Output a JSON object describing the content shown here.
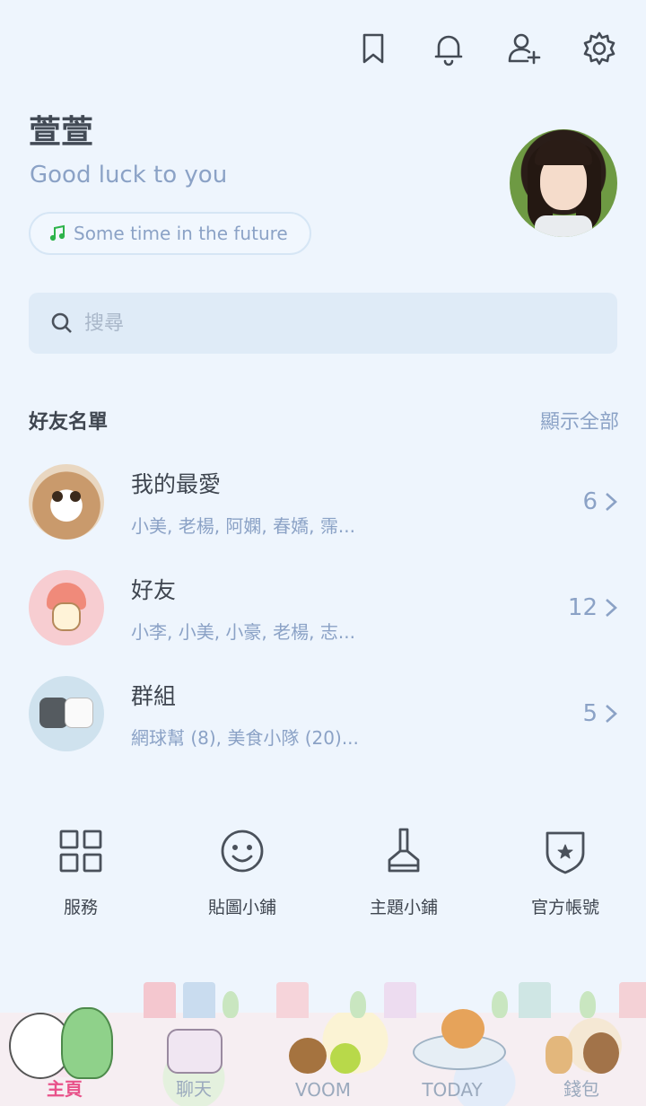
{
  "header": {
    "icons": [
      "bookmark-icon",
      "bell-icon",
      "add-friend-icon",
      "gear-icon"
    ]
  },
  "profile": {
    "name": "萱萱",
    "status": "Good luck to you",
    "music": "Some time in the future"
  },
  "search": {
    "placeholder": "搜尋"
  },
  "friends_section": {
    "title": "好友名單",
    "show_all": "顯示全部",
    "rows": [
      {
        "title": "我的最愛",
        "subtitle": "小美, 老楊, 阿嫻, 春嬌, 霈...",
        "count": "6"
      },
      {
        "title": "好友",
        "subtitle": "小李, 小美, 小豪, 老楊, 志...",
        "count": "12"
      },
      {
        "title": "群組",
        "subtitle": "網球幫 (8), 美食小隊 (20)...",
        "count": "5"
      }
    ]
  },
  "shortcuts": [
    {
      "label": "服務",
      "icon": "grid-icon"
    },
    {
      "label": "貼圖小鋪",
      "icon": "smiley-icon"
    },
    {
      "label": "主題小鋪",
      "icon": "brush-icon"
    },
    {
      "label": "官方帳號",
      "icon": "shield-star-icon"
    }
  ],
  "tabs": [
    {
      "label": "主頁",
      "active": true
    },
    {
      "label": "聊天",
      "active": false
    },
    {
      "label": "VOOM",
      "active": false
    },
    {
      "label": "TODAY",
      "active": false
    },
    {
      "label": "錢包",
      "active": false
    }
  ],
  "colors": {
    "accent": "#e8528a",
    "muted": "#8ba2c6",
    "background": "#eef5fd"
  }
}
